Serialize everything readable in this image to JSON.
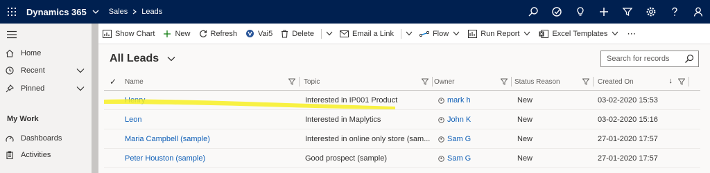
{
  "app": {
    "title": "Dynamics 365"
  },
  "breadcrumb": {
    "area": "Sales",
    "entity": "Leads"
  },
  "topbar": {
    "icons": [
      "search-icon",
      "task-target-icon",
      "lightbulb-icon",
      "plus-icon",
      "filter-icon",
      "gear-icon",
      "help-icon",
      "user-icon"
    ]
  },
  "sidebar": {
    "items": [
      {
        "label": "Home",
        "icon": "home-icon"
      },
      {
        "label": "Recent",
        "icon": "clock-icon"
      },
      {
        "label": "Pinned",
        "icon": "pin-icon"
      }
    ],
    "section_title": "My Work",
    "work_items": [
      {
        "label": "Dashboards",
        "icon": "dashboard-icon"
      },
      {
        "label": "Activities",
        "icon": "clipboard-icon"
      }
    ]
  },
  "commands": {
    "show_chart": "Show Chart",
    "new": "New",
    "refresh": "Refresh",
    "vai5": "Vai5",
    "delete": "Delete",
    "email_link": "Email a Link",
    "flow": "Flow",
    "run_report": "Run Report",
    "excel_templates": "Excel Templates",
    "more": "⋯"
  },
  "view": {
    "title": "All Leads"
  },
  "search": {
    "placeholder": "Search for records"
  },
  "grid": {
    "check_mark": "✓",
    "columns": {
      "name": "Name",
      "topic": "Topic",
      "owner": "Owner",
      "status": "Status Reason",
      "created": "Created On",
      "sort_indicator": "↓"
    },
    "rows": [
      {
        "name": "Henry",
        "topic": "Interested in IP001 Product",
        "owner": "mark h",
        "status": "New",
        "created": "03-02-2020 15:53"
      },
      {
        "name": "Leon",
        "topic": "Interested in Maplytics",
        "owner": "John K",
        "status": "New",
        "created": "03-02-2020 15:16"
      },
      {
        "name": "Maria Campbell (sample)",
        "topic": "Interested in online only store (sam...",
        "owner": "Sam G",
        "status": "New",
        "created": "27-01-2020 17:57"
      },
      {
        "name": "Peter Houston (sample)",
        "topic": "Good prospect (sample)",
        "owner": "Sam G",
        "status": "New",
        "created": "27-01-2020 17:57"
      }
    ]
  },
  "colors": {
    "topbar": "#002050",
    "link": "#1160b7",
    "highlight": "#f7f023"
  }
}
